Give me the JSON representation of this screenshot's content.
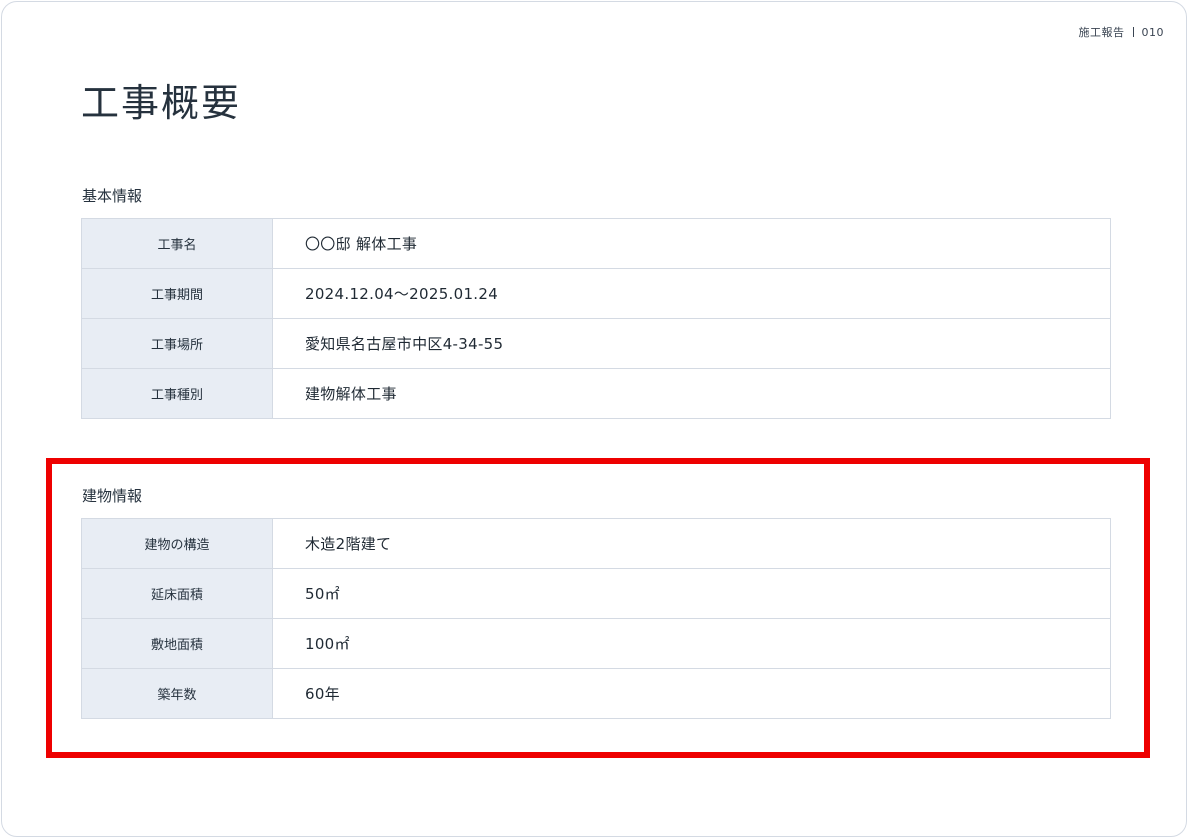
{
  "header": {
    "doc_name": "施工報告",
    "page_number": "010"
  },
  "title": "工事概要",
  "basic_info": {
    "label": "基本情報",
    "rows": [
      {
        "key": "工事名",
        "value": "〇〇邸 解体工事"
      },
      {
        "key": "工事期間",
        "value": "2024.12.04〜2025.01.24"
      },
      {
        "key": "工事場所",
        "value": "愛知県名古屋市中区4-34-55"
      },
      {
        "key": "工事種別",
        "value": "建物解体工事"
      }
    ]
  },
  "building_info": {
    "label": "建物情報",
    "rows": [
      {
        "key": "建物の構造",
        "value": "木造2階建て"
      },
      {
        "key": "延床面積",
        "value": "50㎡"
      },
      {
        "key": "敷地面積",
        "value": "100㎡"
      },
      {
        "key": "築年数",
        "value": "60年"
      }
    ]
  },
  "colors": {
    "highlight": "#ee0000",
    "key_cell_bg": "#e8edf4",
    "border": "#d4dae3"
  }
}
